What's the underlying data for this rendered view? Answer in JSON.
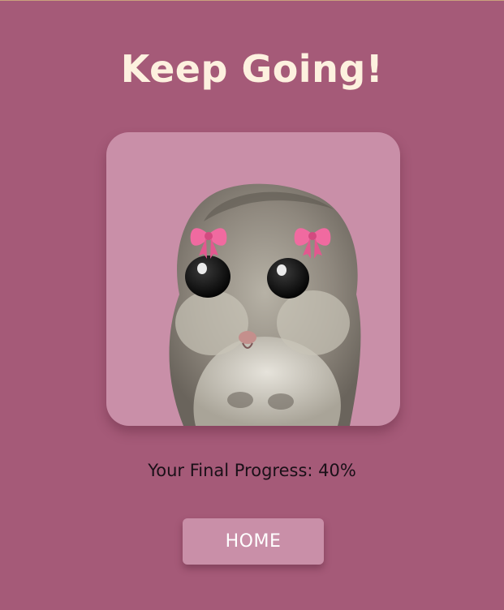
{
  "heading": "Keep Going!",
  "image": {
    "subject": "hamster-with-pink-bows",
    "icon": "bow-icon"
  },
  "progress": {
    "label": "Your Final Progress: 40%",
    "value_percent": 40
  },
  "home_button": {
    "label": "HOME"
  },
  "colors": {
    "background": "#a55a78",
    "card": "#c98fa8",
    "title": "#fdf1df",
    "bow": "#f06aa0"
  }
}
